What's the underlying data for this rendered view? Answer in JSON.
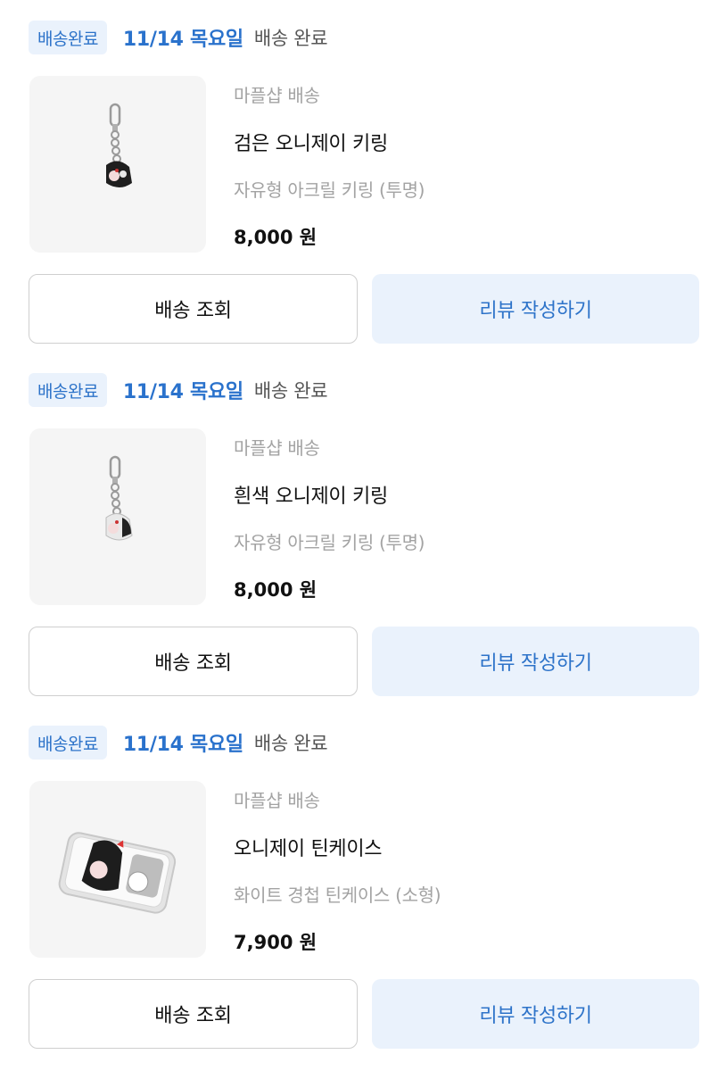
{
  "orders": [
    {
      "badge": "배송완료",
      "date": "11/14 목요일",
      "status": "배송 완료",
      "seller": "마플샵 배송",
      "name": "검은 오니제이 키링",
      "option": "자유형 아크릴 키링 (투명)",
      "price": "8,000 원",
      "image": "keyring-black",
      "track_label": "배송 조회",
      "review_label": "리뷰 작성하기"
    },
    {
      "badge": "배송완료",
      "date": "11/14 목요일",
      "status": "배송 완료",
      "seller": "마플샵 배송",
      "name": "흰색 오니제이 키링",
      "option": "자유형 아크릴 키링 (투명)",
      "price": "8,000 원",
      "image": "keyring-white",
      "track_label": "배송 조회",
      "review_label": "리뷰 작성하기"
    },
    {
      "badge": "배송완료",
      "date": "11/14 목요일",
      "status": "배송 완료",
      "seller": "마플샵 배송",
      "name": "오니제이 틴케이스",
      "option": "화이트 경첩 틴케이스 (소형)",
      "price": "7,900 원",
      "image": "tin-case",
      "track_label": "배송 조회",
      "review_label": "리뷰 작성하기"
    }
  ],
  "colors": {
    "accent": "#2d73c9",
    "accent_bg": "#eaf2fc",
    "muted_text": "#a3a3a3",
    "thumb_bg": "#f5f5f5"
  }
}
